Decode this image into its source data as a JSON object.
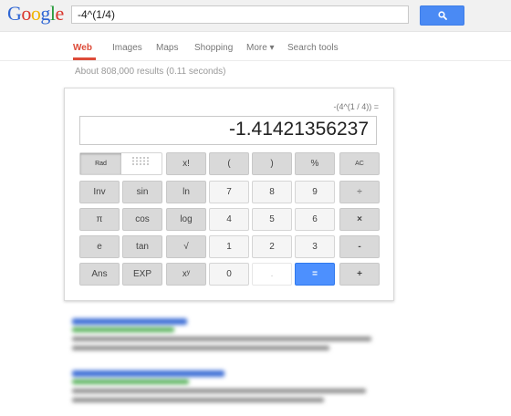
{
  "header": {
    "logo": {
      "letters": [
        "G",
        "o",
        "o",
        "g",
        "l",
        "e"
      ],
      "colors": [
        "#2f66d4",
        "#d9352b",
        "#f0b400",
        "#2f66d4",
        "#279a3a",
        "#d9352b"
      ]
    },
    "search_value": "-4^(1/4)"
  },
  "tabs": [
    {
      "label": "Web",
      "active": true
    },
    {
      "label": "Images",
      "active": false
    },
    {
      "label": "Maps",
      "active": false
    },
    {
      "label": "Shopping",
      "active": false
    },
    {
      "label": "More ▾",
      "active": false
    },
    {
      "label": "Search tools",
      "active": false
    }
  ],
  "result_stats": "About 808,000 results (0.11 seconds)",
  "calculator": {
    "expression": "-(4^(1 / 4)) =",
    "display": "-1.41421356237",
    "rad_label": "Rad",
    "deg_label": "Deg",
    "rows": [
      [
        "Rad|Deg",
        "x!",
        "(",
        ")",
        "%",
        "AC"
      ],
      [
        "Inv",
        "sin",
        "ln",
        "7",
        "8",
        "9",
        "÷"
      ],
      [
        "π",
        "cos",
        "log",
        "4",
        "5",
        "6",
        "×"
      ],
      [
        "e",
        "tan",
        "√",
        "1",
        "2",
        "3",
        "-"
      ],
      [
        "Ans",
        "EXP",
        "xʸ",
        "0",
        ".",
        "=",
        "+"
      ]
    ]
  },
  "colors": {
    "accent_blue": "#4d90fe",
    "active_tab": "#dd4b39",
    "key_gray": "#d9d9d9",
    "key_light": "#f5f5f5"
  }
}
